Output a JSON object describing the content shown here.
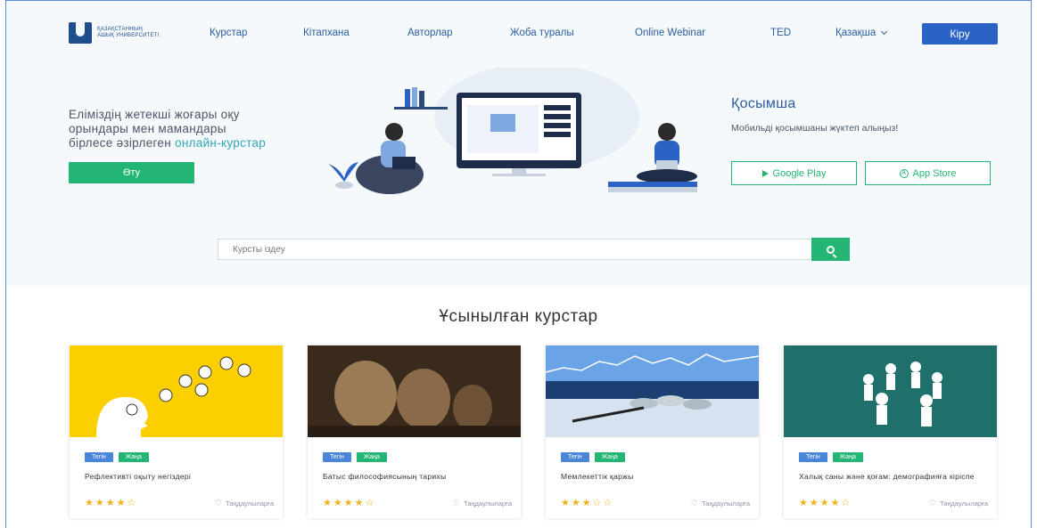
{
  "header": {
    "logo_text": "ҚАЗАҚСТАННЫҢ АШЫҚ УНИВЕРСИТЕТІ",
    "nav": [
      "Курстар",
      "Кітапхана",
      "Авторлар",
      "Жоба туралы",
      "Online Webinar",
      "TED"
    ],
    "language": "Қазақша",
    "login_label": "Кіру"
  },
  "hero": {
    "text_line1": "Еліміздің жетекші жоғары оқу",
    "text_line2": "орындары мен мамандары",
    "text_line3_prefix": "бірлесе әзірлеген ",
    "text_line3_accent": "онлайн-курстар",
    "cta_label": "Өту",
    "app_title": "Қосымша",
    "app_subtitle": "Мобильді қосымшаны жүктеп алыңыз!",
    "google_play_label": "Google Play",
    "app_store_label": "App Store"
  },
  "search": {
    "placeholder": "Курсты іздеу"
  },
  "featured": {
    "title": "Ұсынылған курстар",
    "favorites_label": "Таңдаулыларға",
    "courses": [
      {
        "tag1": "Тегін",
        "tag2": "Жаңа",
        "title": "Рефлективті оқыту негіздері",
        "stars": "★★★★☆",
        "rating": 4
      },
      {
        "tag1": "Тегін",
        "tag2": "Жаңа",
        "title": "Батыс философиясының тарихы",
        "stars": "★★★★☆",
        "rating": 4
      },
      {
        "tag1": "Тегін",
        "tag2": "Жаңа",
        "title": "Мемлекеттік қаржы",
        "stars": "★★★☆☆",
        "rating": 3
      },
      {
        "tag1": "Тегін",
        "tag2": "Жаңа",
        "title": "Халық саны және қоғам: демографияға кіріспе",
        "stars": "★★★★☆",
        "rating": 4
      }
    ]
  },
  "colors": {
    "brand_blue": "#2b63c4",
    "accent_green": "#22b573",
    "nav_blue": "#2a5d9f",
    "star_gold": "#f2b01e"
  }
}
